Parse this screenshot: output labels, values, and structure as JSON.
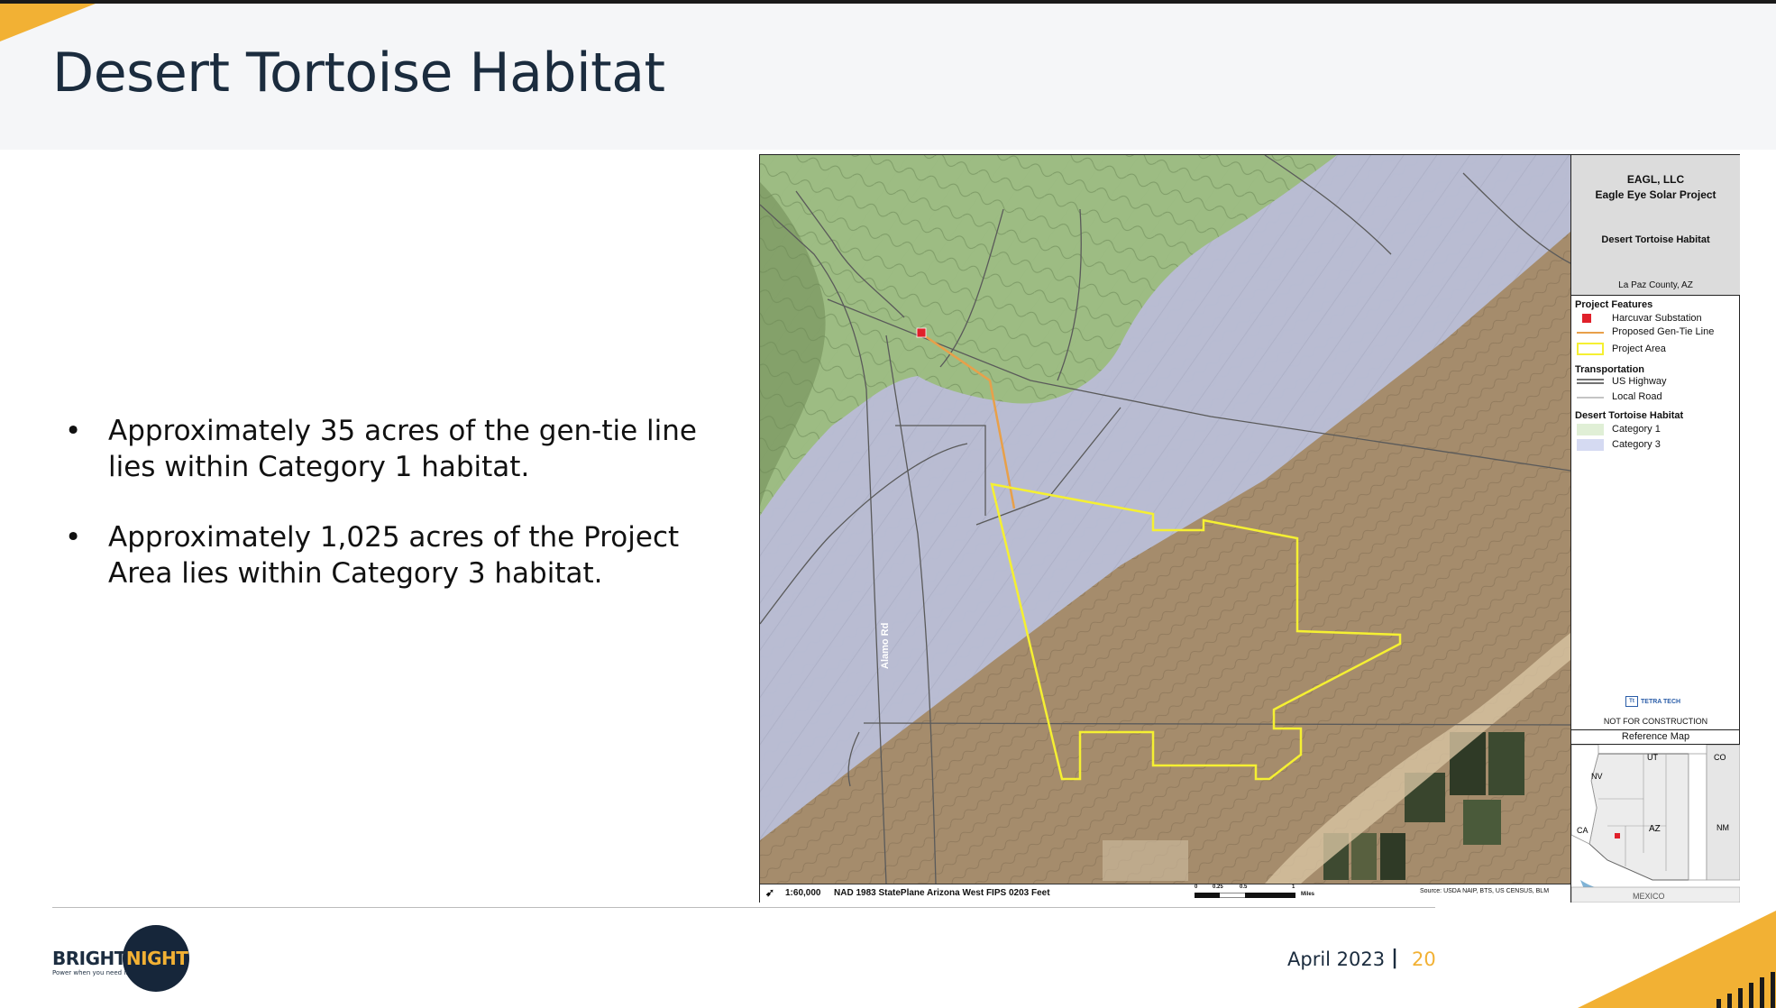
{
  "slide": {
    "title": "Desert Tortoise Habitat",
    "bullets": [
      "Approximately  35 acres of the gen-tie line lies within Category 1 habitat.",
      "Approximately  1,025 acres of the Project Area lies within Category 3 habitat."
    ],
    "footer_date": "April 2023",
    "footer_separator": "|",
    "page_number": "20",
    "colors": {
      "accent": "#f2b134",
      "navy": "#16263a"
    }
  },
  "logo": {
    "word_1": "BRIGHT",
    "word_2": "NIGHT",
    "tagline": "Power when you need it"
  },
  "map": {
    "road_label": "Alamo Rd",
    "title_block": {
      "company": "EAGL, LLC",
      "project": "Eagle Eye Solar Project",
      "map_title": "Desert Tortoise Habitat",
      "location": "La Paz County, AZ"
    },
    "legend": {
      "project_features_heading": "Project Features",
      "substation": "Harcuvar Substation",
      "gen_tie": "Proposed Gen-Tie Line",
      "project_area": "Project Area",
      "transportation_heading": "Transportation",
      "us_highway": "US Highway",
      "local_road": "Local Road",
      "habitat_heading": "Desert Tortoise Habitat",
      "category_1": "Category 1",
      "category_3": "Category 3"
    },
    "logo_text": "TETRA TECH",
    "logo_mark": "Tt",
    "not_for_construction": "NOT FOR CONSTRUCTION",
    "reference_map": {
      "title": "Reference Map",
      "labels": {
        "nv": "NV",
        "ut": "UT",
        "co": "CO",
        "ca": "CA",
        "az": "AZ",
        "nm": "NM",
        "mexico": "MEXICO"
      }
    },
    "footer": {
      "scale": "1:60,000",
      "projection": "NAD 1983 StatePlane Arizona West FIPS 0203 Feet",
      "scalebar_ticks": [
        "0",
        "0.25",
        "0.5",
        "1"
      ],
      "scalebar_unit": "Miles",
      "source": "Source: USDA NAIP, BTS, US CENSUS, BLM"
    },
    "colors": {
      "category_1": "#c8ddb0",
      "category_3": "#c9cfe6",
      "project_area": "#f5f032",
      "gen_tie": "#e8a04a",
      "substation": "#e0202a"
    }
  }
}
